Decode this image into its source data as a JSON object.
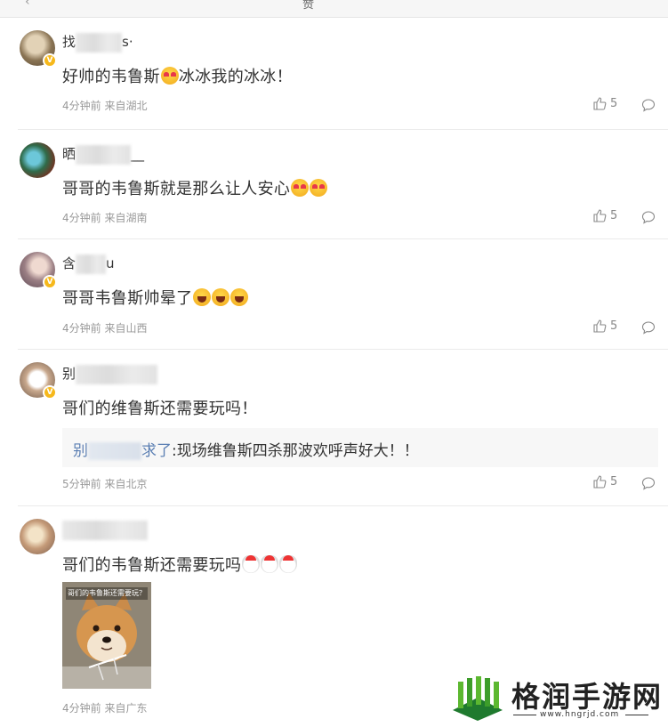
{
  "topbar": {
    "back_glyph": "‹",
    "tab_fragment": "赞"
  },
  "comments": [
    {
      "username_prefix": "找",
      "username_suffix": "s·",
      "text": "好帅的韦鲁斯",
      "text_after_emoji": "冰冰我的冰冰！",
      "emoji": [
        "heart-eyes-emoji"
      ],
      "time": "4分钟前",
      "location": "来自湖北",
      "likes": "5",
      "verified": true
    },
    {
      "username_prefix": "晒",
      "username_suffix": "__",
      "text": "哥哥的韦鲁斯就是那么让人安心",
      "text_after_emoji": "",
      "emoji": [
        "heart-eyes-emoji",
        "heart-eyes-emoji"
      ],
      "time": "4分钟前",
      "location": "来自湖南",
      "likes": "5",
      "verified": false
    },
    {
      "username_prefix": "含",
      "username_suffix": "u",
      "text": "哥哥韦鲁斯帅晕了",
      "text_after_emoji": "",
      "emoji": [
        "laughing-emoji",
        "laughing-emoji",
        "laughing-emoji"
      ],
      "time": "4分钟前",
      "location": "来自山西",
      "likes": "5",
      "verified": true
    },
    {
      "username_prefix": "别",
      "username_suffix": "",
      "text": "哥们的维鲁斯还需要玩吗！",
      "text_after_emoji": "",
      "emoji": [],
      "quote": {
        "name_prefix": "别",
        "name_suffix": "求了",
        "text": ":现场维鲁斯四杀那波欢呼声好大！！"
      },
      "time": "5分钟前",
      "location": "来自北京",
      "likes": "5",
      "verified": true
    },
    {
      "username_prefix": "",
      "username_suffix": "",
      "text": "哥们的韦鲁斯还需要玩吗",
      "text_after_emoji": "",
      "emoji": [
        "chicken-emoji",
        "chicken-emoji",
        "chicken-emoji"
      ],
      "image_caption": "哥们的韦鲁斯还需要玩？",
      "time": "4分钟前",
      "location": "来自广东",
      "likes": "",
      "verified": false
    }
  ],
  "watermark": {
    "title": "格润手游网",
    "url": "www.hngrjd.com"
  },
  "colors": {
    "verified_badge": "#f6b81b",
    "quote_link": "#5b7fb3",
    "meta_text": "#999999"
  }
}
